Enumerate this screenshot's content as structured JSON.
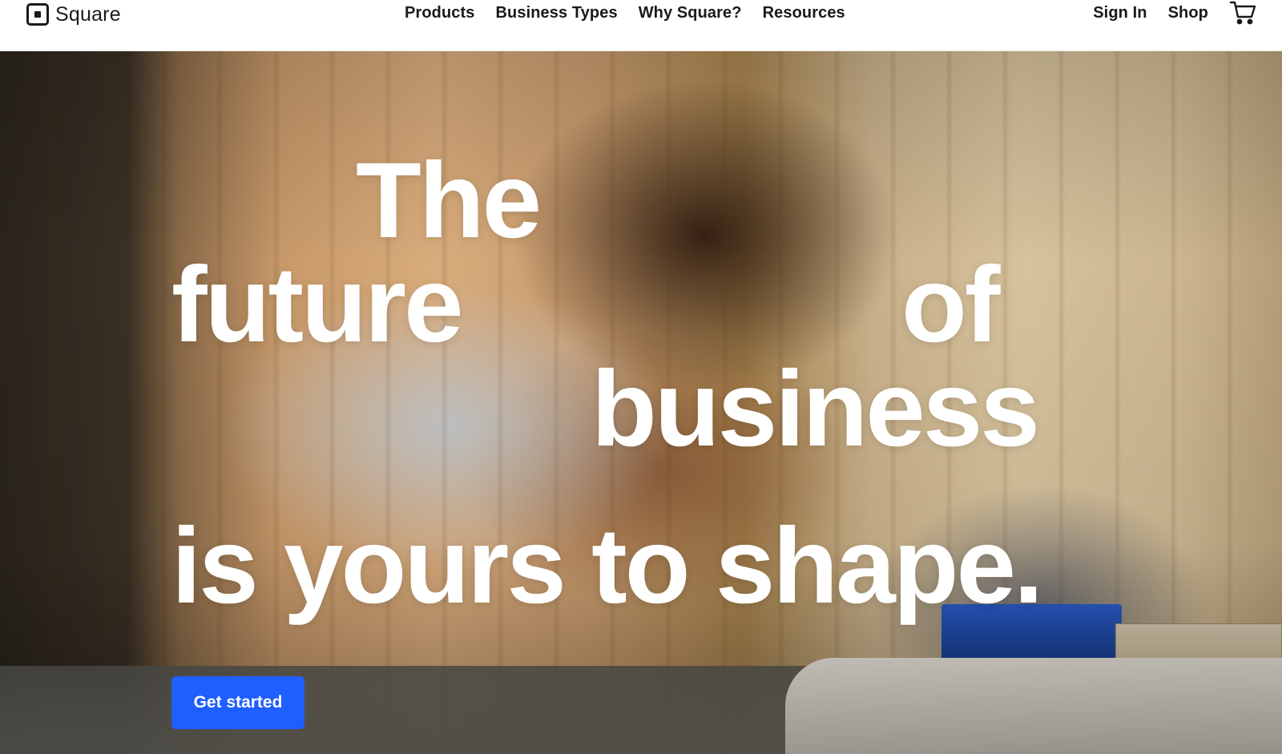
{
  "header": {
    "logo_text": "Square",
    "nav": {
      "products": "Products",
      "business_types": "Business Types",
      "why_square": "Why Square?",
      "resources": "Resources"
    },
    "right": {
      "sign_in": "Sign In",
      "shop": "Shop",
      "cart_icon": "cart-icon"
    }
  },
  "hero": {
    "headline": {
      "line1": "The",
      "line2a": "future",
      "line2b": "of",
      "line3": "business",
      "line4": "is yours to shape."
    },
    "cta_label": "Get started",
    "colors": {
      "cta_background": "#1f5eff",
      "headline_text": "#ffffff"
    }
  }
}
